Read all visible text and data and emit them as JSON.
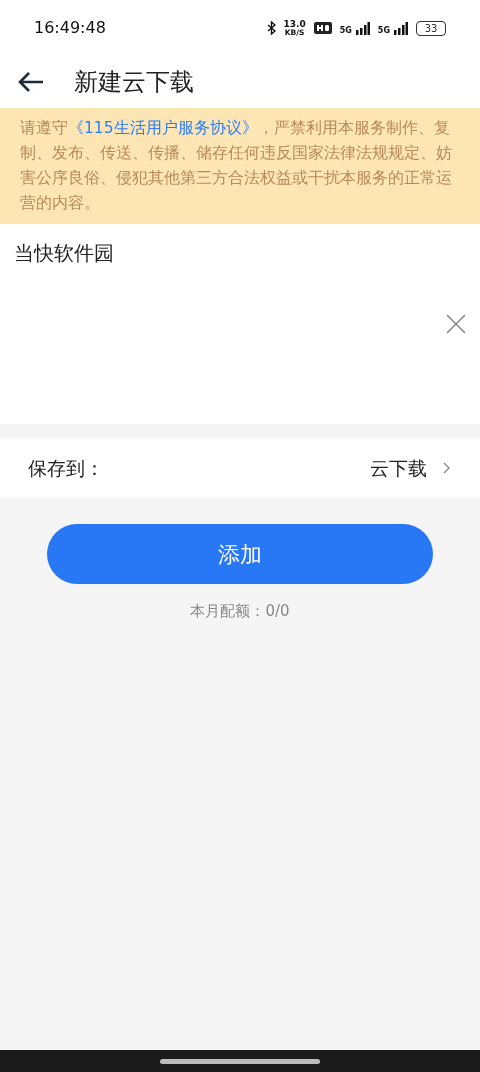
{
  "status_bar": {
    "time": "16:49:48",
    "net_speed": "13.0",
    "net_unit": "KB/S",
    "sim_1": "5G",
    "sim_2": "5G",
    "battery": "33"
  },
  "header": {
    "title": "新建云下载"
  },
  "notice": {
    "before": "请遵守",
    "link": "《115生活用户服务协议》",
    "after": "，严禁利用本服务制作、复制、发布、传送、传播、储存任何违反国家法律法规规定、妨害公序良俗、侵犯其他第三方合法权益或干扰本服务的正常运营的内容。"
  },
  "link_input": {
    "value": "当快软件园"
  },
  "save_to": {
    "label": "保存到：",
    "value": "云下载"
  },
  "add_button": {
    "label": "添加"
  },
  "quota": "本月配额：0/0"
}
